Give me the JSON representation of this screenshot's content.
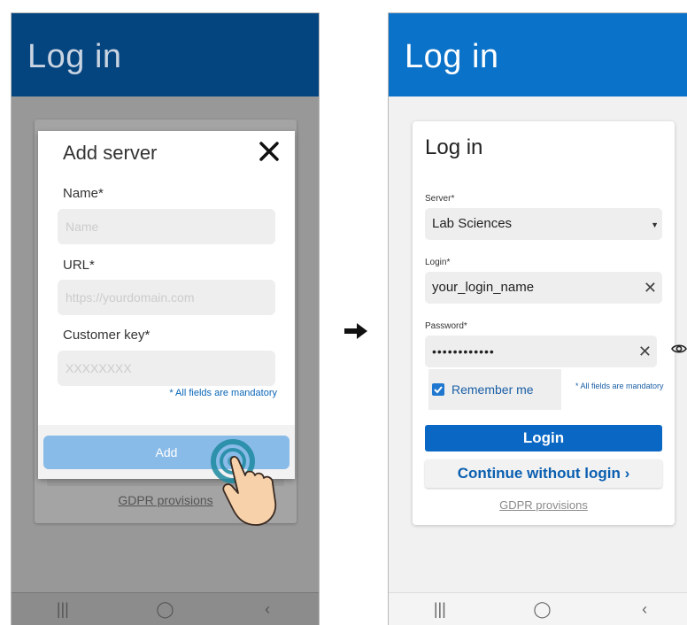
{
  "left_screen": {
    "appbar_title": "Log in",
    "background_gdpr_link": "GDPR provisions",
    "dialog": {
      "title": "Add server",
      "close_icon": "close-icon",
      "fields": [
        {
          "label": "Name*",
          "placeholder": "Name"
        },
        {
          "label": "URL*",
          "placeholder": "https://yourdomain.com"
        },
        {
          "label": "Customer key*",
          "placeholder": "XXXXXXXX"
        }
      ],
      "mandatory_note": "* All fields are mandatory",
      "add_button": "Add"
    },
    "navbar": {
      "recents": "|||",
      "home": "◯",
      "back": "‹"
    }
  },
  "transition_arrow": "right-arrow-icon",
  "right_screen": {
    "appbar_title": "Log in",
    "card": {
      "title": "Log in",
      "server": {
        "label": "Server*",
        "value": "Lab Sciences"
      },
      "login": {
        "label": "Login*",
        "value": "your_login_name"
      },
      "password": {
        "label": "Password*",
        "value": "••••••••••••"
      },
      "remember_me": {
        "label": "Remember me",
        "checked": true
      },
      "mandatory_note": "* All fields are mandatory",
      "login_button": "Login",
      "continue_button": "Continue without login  ›",
      "gdpr_link": "GDPR provisions"
    },
    "navbar": {
      "recents": "|||",
      "home": "◯",
      "back": "‹"
    }
  },
  "colors": {
    "dark_appbar": "#04447f",
    "appbar": "#0a72c9",
    "primary_button": "#0a67c3",
    "add_button_disabled": "#89bbe8",
    "link_blue": "#1a5fa6"
  }
}
